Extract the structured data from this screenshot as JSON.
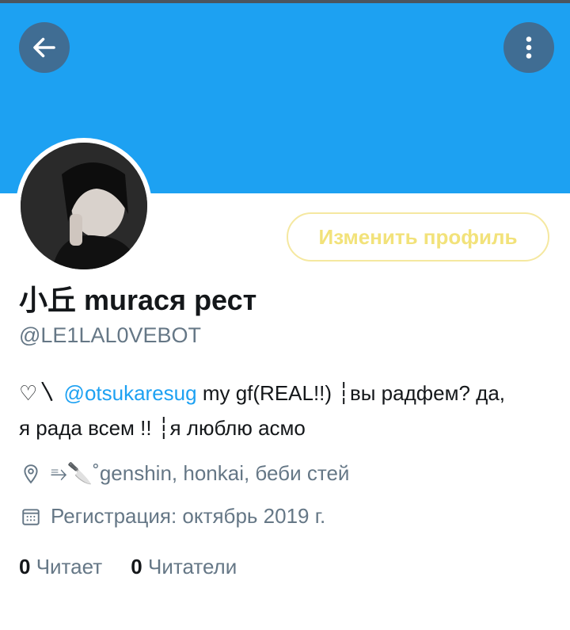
{
  "header": {
    "back_icon": "arrow-left-icon",
    "menu_icon": "more-vertical-icon",
    "banner_color": "#1da1f2"
  },
  "profile": {
    "name": "小丘 muraся рест",
    "handle": "@LE1LAL0VEBOT",
    "edit_button_label": "Изменить профиль",
    "bio": {
      "prefix": "♡〵 ",
      "mention": "@otsukaresug",
      "line1_rest": " my gf(REAL!!) ┆вы радфем? да,",
      "line2": "я рада всем !! ┆я люблю асмо"
    },
    "location": "⥱🔪˚genshin, honkai, беби стей",
    "registration": "Регистрация: октябрь 2019 г.",
    "following_count": "0",
    "following_label": "Читает",
    "followers_count": "0",
    "followers_label": "Читатели"
  },
  "colors": {
    "accent": "#1da1f2",
    "muted_text": "#657786",
    "edit_button_text": "#f2e27a"
  }
}
